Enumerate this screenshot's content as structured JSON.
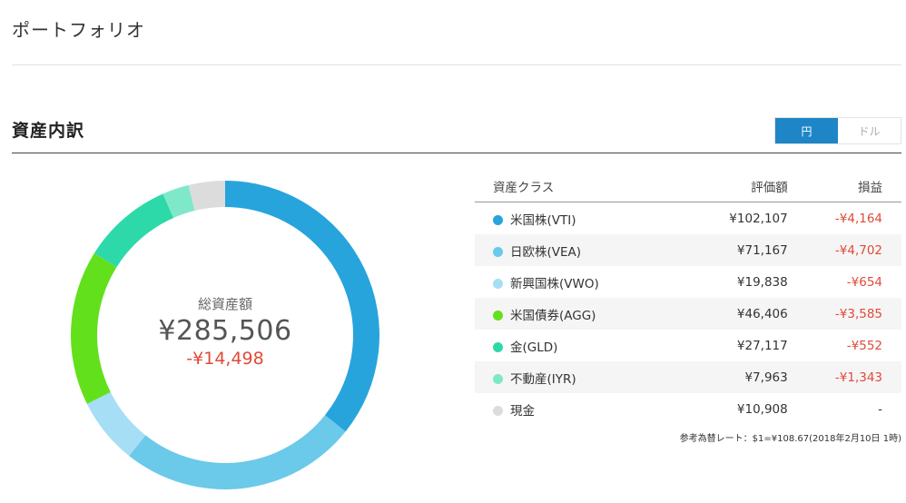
{
  "page": {
    "title": "ポートフォリオ"
  },
  "section": {
    "title": "資産内訳"
  },
  "currency_toggle": {
    "yen_label": "円",
    "dollar_label": "ドル",
    "selected": "円"
  },
  "colors": {
    "accent": "#1e86c7",
    "loss": "#e04a3a",
    "vti": "#27a4dc",
    "vea": "#6bc9ea",
    "vwo": "#a6def5",
    "agg": "#63e01c",
    "gld": "#2dd9a8",
    "iyr": "#7fe8c8",
    "cash": "#dcdcdc"
  },
  "summary": {
    "label": "総資産額",
    "total": "¥285,506",
    "gain": "-¥14,498"
  },
  "table": {
    "headers": {
      "asset_class": "資産クラス",
      "value": "評価額",
      "gain": "損益"
    },
    "rows": [
      {
        "name": "米国株(VTI)",
        "value": "¥102,107",
        "gain": "-¥4,164",
        "color": "#27a4dc",
        "icon": "vti-color-dot"
      },
      {
        "name": "日欧株(VEA)",
        "value": "¥71,167",
        "gain": "-¥4,702",
        "color": "#6bc9ea",
        "icon": "vea-color-dot"
      },
      {
        "name": "新興国株(VWO)",
        "value": "¥19,838",
        "gain": "-¥654",
        "color": "#a6def5",
        "icon": "vwo-color-dot"
      },
      {
        "name": "米国債券(AGG)",
        "value": "¥46,406",
        "gain": "-¥3,585",
        "color": "#63e01c",
        "icon": "agg-color-dot"
      },
      {
        "name": "金(GLD)",
        "value": "¥27,117",
        "gain": "-¥552",
        "color": "#2dd9a8",
        "icon": "gld-color-dot"
      },
      {
        "name": "不動産(IYR)",
        "value": "¥7,963",
        "gain": "-¥1,343",
        "color": "#7fe8c8",
        "icon": "iyr-color-dot"
      },
      {
        "name": "現金",
        "value": "¥10,908",
        "gain": "-",
        "color": "#dcdcdc",
        "icon": "cash-color-dot"
      }
    ]
  },
  "exchange_note": "参考為替レート：$1=¥108.67(2018年2月10日 1時)",
  "chart_data": {
    "type": "pie",
    "categories": [
      "米国株(VTI)",
      "日欧株(VEA)",
      "新興国株(VWO)",
      "米国債券(AGG)",
      "金(GLD)",
      "不動産(IYR)",
      "現金"
    ],
    "values": [
      102107,
      71167,
      19838,
      46406,
      27117,
      7963,
      10908
    ],
    "colors": [
      "#27a4dc",
      "#6bc9ea",
      "#a6def5",
      "#63e01c",
      "#2dd9a8",
      "#7fe8c8",
      "#dcdcdc"
    ],
    "donut": true
  }
}
